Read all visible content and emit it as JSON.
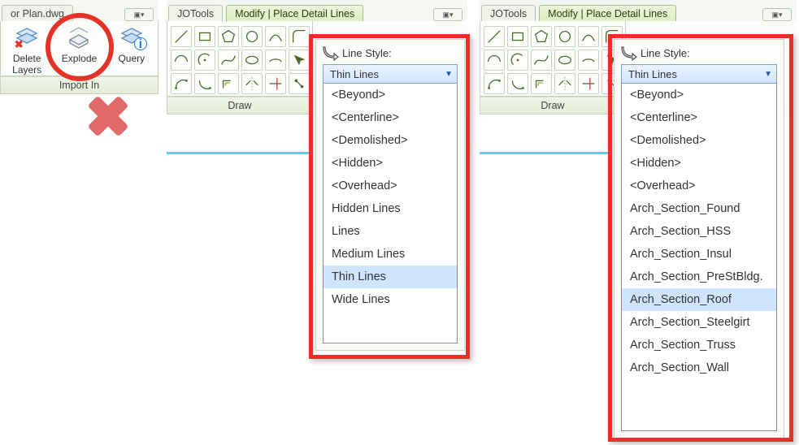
{
  "panel1": {
    "tab_trunc": "or Plan.dwg",
    "buttons": {
      "delete": {
        "label": "Delete",
        "sublabel": "Layers"
      },
      "explode": {
        "label": "Explode"
      },
      "query": {
        "label": "Query"
      }
    },
    "group_label": "Import In"
  },
  "panel2": {
    "tab_jo": "JOTools",
    "tab_modify": "Modify | Place Detail Lines",
    "group_label": "Draw",
    "line_style_label": "Line Style:",
    "selected": "Thin Lines",
    "items": [
      "<Beyond>",
      "<Centerline>",
      "<Demolished>",
      "<Hidden>",
      "<Overhead>",
      "Hidden Lines",
      "Lines",
      "Medium Lines",
      "Thin Lines",
      "Wide Lines"
    ],
    "highlight_index": 8
  },
  "panel3": {
    "tab_jo": "JOTools",
    "tab_modify": "Modify | Place Detail Lines",
    "group_label": "Draw",
    "line_style_label": "Line Style:",
    "selected": "Thin Lines",
    "items": [
      "<Beyond>",
      "<Centerline>",
      "<Demolished>",
      "<Hidden>",
      "<Overhead>",
      "Arch_Section_Found",
      "Arch_Section_HSS",
      "Arch_Section_Insul",
      "Arch_Section_PreStBldg.",
      "Arch_Section_Roof",
      "Arch_Section_Steelgirt",
      "Arch_Section_Truss",
      "Arch_Section_Wall"
    ],
    "highlight_index": 9
  },
  "draw_icons": [
    "line",
    "rect",
    "poly",
    "circle",
    "arc3",
    "fillet",
    "arc",
    "arcC",
    "spline",
    "ellipse",
    "earc",
    "pick",
    "arcSE",
    "arcTE",
    "offset",
    "mirror",
    "trim",
    "ptsel"
  ]
}
